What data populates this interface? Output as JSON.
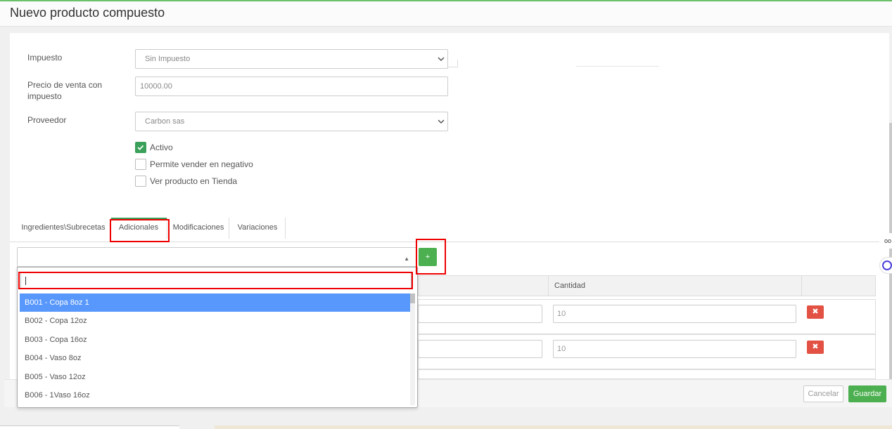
{
  "header": {
    "title": "Nuevo producto compuesto"
  },
  "form": {
    "impuesto": {
      "label": "Impuesto",
      "value": "Sin Impuesto"
    },
    "precio": {
      "label": "Precio de venta con impuesto",
      "value": "10000.00"
    },
    "proveedor": {
      "label": "Proveedor",
      "value": "Carbon sas"
    },
    "checks": [
      {
        "label": "Activo",
        "checked": true
      },
      {
        "label": "Permite vender en negativo",
        "checked": false
      },
      {
        "label": "Ver producto en Tienda",
        "checked": false
      }
    ]
  },
  "tabs": [
    {
      "label": "Ingredientes\\Subrecetas"
    },
    {
      "label": "Adicionales",
      "active": true
    },
    {
      "label": "Modificaciones"
    },
    {
      "label": "Variaciones"
    }
  ],
  "adicionales": {
    "add_label": "+",
    "search_value": "",
    "options": [
      "B001 - Copa 8oz 1",
      "B002 - Copa 12oz",
      "B003 - Copa 16oz",
      "B004 - Vaso 8oz",
      "B005 - Vaso 12oz",
      "B006 - 1Vaso 16oz"
    ],
    "table": {
      "headers": [
        "",
        "Cantidad",
        ""
      ],
      "rows": [
        {
          "cantidad": "10",
          "delete": "✖"
        },
        {
          "cantidad": "10",
          "delete": "✖"
        }
      ]
    }
  },
  "footer": {
    "cancel_label": "Cancelar",
    "save_label": "Guardar"
  },
  "side_widget": {
    "text": "oo"
  },
  "colors": {
    "accent": "#4caf50",
    "danger": "#e25143",
    "highlight": "#5897fb",
    "annotation": "#ee0000"
  }
}
